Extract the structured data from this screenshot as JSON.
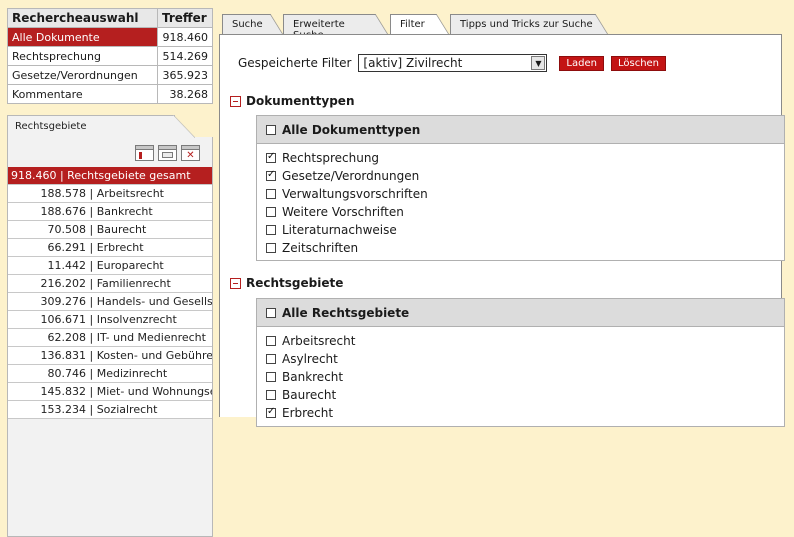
{
  "left": {
    "header_col1": "Rechercheauswahl",
    "header_col2": "Treffer",
    "rows": [
      {
        "label": "Alle Dokumente",
        "count": "918.460",
        "active": true
      },
      {
        "label": "Rechtsprechung",
        "count": "514.269",
        "active": false
      },
      {
        "label": "Gesetze/Verordnungen",
        "count": "365.923",
        "active": false
      },
      {
        "label": "Kommentare",
        "count": "38.268",
        "active": false
      }
    ],
    "rg_tab": "Rechtsgebiete",
    "rg_total": "918.460 | Rechtsgebiete gesamt",
    "rg_items": [
      {
        "n": "188.578",
        "label": "Arbeitsrecht"
      },
      {
        "n": "188.676",
        "label": "Bankrecht"
      },
      {
        "n": "70.508",
        "label": "Baurecht"
      },
      {
        "n": "66.291",
        "label": "Erbrecht"
      },
      {
        "n": "11.442",
        "label": "Europarecht"
      },
      {
        "n": "216.202",
        "label": "Familienrecht"
      },
      {
        "n": "309.276",
        "label": "Handels- und Gesellsc"
      },
      {
        "n": "106.671",
        "label": "Insolvenzrecht"
      },
      {
        "n": "62.208",
        "label": "IT- und Medienrecht"
      },
      {
        "n": "136.831",
        "label": "Kosten- und Gebühre"
      },
      {
        "n": "80.746",
        "label": "Medizinrecht"
      },
      {
        "n": "145.832",
        "label": "Miet- und Wohnungse"
      },
      {
        "n": "153.234",
        "label": "Sozialrecht"
      }
    ]
  },
  "tabs": [
    "Suche",
    "Erweiterte Suche",
    "Filter",
    "Tipps und Tricks zur Suche"
  ],
  "filter": {
    "label": "Gespeicherte Filter",
    "selected": "[aktiv] Zivilrecht",
    "load": "Laden",
    "delete": "Löschen"
  },
  "doktypen": {
    "title": "Dokumenttypen",
    "all_label": "Alle Dokumenttypen",
    "items": [
      {
        "label": "Rechtsprechung",
        "checked": true
      },
      {
        "label": "Gesetze/Verordnungen",
        "checked": true
      },
      {
        "label": "Verwaltungsvorschriften",
        "checked": false
      },
      {
        "label": "Weitere Vorschriften",
        "checked": false
      },
      {
        "label": "Literaturnachweise",
        "checked": false
      },
      {
        "label": "Zeitschriften",
        "checked": false
      }
    ]
  },
  "rechtsgebiete": {
    "title": "Rechtsgebiete",
    "all_label": "Alle Rechtsgebiete",
    "items": [
      {
        "label": "Arbeitsrecht",
        "checked": false
      },
      {
        "label": "Asylrecht",
        "checked": false
      },
      {
        "label": "Bankrecht",
        "checked": false
      },
      {
        "label": "Baurecht",
        "checked": false
      },
      {
        "label": "Erbrecht",
        "checked": true
      }
    ]
  }
}
